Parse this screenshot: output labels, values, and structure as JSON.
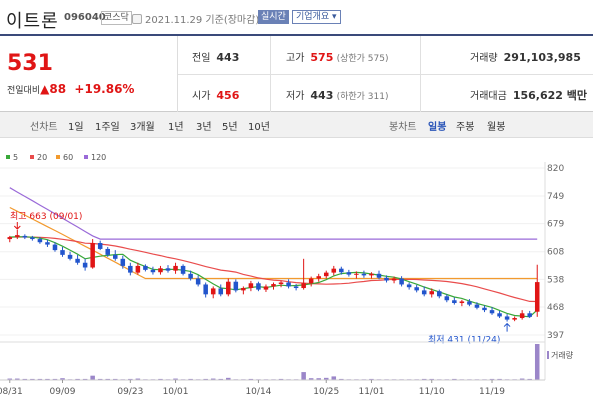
{
  "header": {
    "stock_name": "이트론",
    "stock_code": "096040",
    "market": "코스닥",
    "date": "2021.11.29 기준(장마감)",
    "realtime_label": "실시간",
    "company_label": "기업개요 ▾"
  },
  "price": {
    "current": "531",
    "change_label": "전일대비",
    "change_value": "▲88",
    "change_pct": "+19.86%"
  },
  "stats": {
    "prev_close_label": "전일",
    "prev_close": "443",
    "high_label": "고가",
    "high": "575",
    "high_sub": "(상한가 575)",
    "volume_label": "거래량",
    "volume": "291,103,985",
    "open_label": "시가",
    "open": "456",
    "low_label": "저가",
    "low": "443",
    "low_sub": "(하한가 311)",
    "amount_label": "거래대금",
    "amount": "156,622 백만"
  },
  "periods": {
    "line_chart_label": "선차트",
    "line_options": [
      "1일",
      "1주일",
      "3개월",
      "1년",
      "3년",
      "5년",
      "10년"
    ],
    "candle_chart_label": "봉차트",
    "candle_options": [
      "일봉",
      "주봉",
      "월봉"
    ],
    "active_candle": "일봉"
  },
  "colors": {
    "up": "#e01515",
    "down": "#2255cc",
    "ma5": "#39a839",
    "ma20": "#e94c4c",
    "ma60": "#f29a2e",
    "ma120": "#9a6ad8",
    "volume": "#9b86c9"
  },
  "chart_data": {
    "type": "candlestick",
    "legend": [
      {
        "name": "5",
        "color": "#39a839"
      },
      {
        "name": "20",
        "color": "#e94c4c"
      },
      {
        "name": "60",
        "color": "#f29a2e"
      },
      {
        "name": "120",
        "color": "#9a6ad8"
      }
    ],
    "y_ticks": [
      820,
      749,
      679,
      608,
      538,
      468,
      397
    ],
    "ylim": [
      397,
      820
    ],
    "x_ticks": [
      "08/31",
      "09/09",
      "09/23",
      "10/01",
      "10/14",
      "10/25",
      "11/01",
      "11/10",
      "11/19"
    ],
    "annotations": {
      "high": "최고 663 (09/01)",
      "low": "최저 431 (11/24)"
    },
    "volume_label": "거래량",
    "candles": [
      [
        640,
        648,
        632,
        645
      ],
      [
        645,
        663,
        640,
        650
      ],
      [
        648,
        652,
        640,
        644
      ],
      [
        644,
        648,
        636,
        640
      ],
      [
        640,
        645,
        628,
        632
      ],
      [
        632,
        638,
        620,
        626
      ],
      [
        626,
        632,
        608,
        612
      ],
      [
        612,
        620,
        595,
        600
      ],
      [
        600,
        608,
        586,
        590
      ],
      [
        590,
        600,
        575,
        580
      ],
      [
        580,
        590,
        560,
        568
      ],
      [
        568,
        640,
        565,
        630
      ],
      [
        630,
        636,
        612,
        615
      ],
      [
        615,
        620,
        595,
        600
      ],
      [
        600,
        612,
        585,
        590
      ],
      [
        590,
        598,
        565,
        572
      ],
      [
        572,
        580,
        548,
        555
      ],
      [
        555,
        580,
        550,
        572
      ],
      [
        572,
        576,
        558,
        562
      ],
      [
        562,
        570,
        550,
        556
      ],
      [
        556,
        572,
        550,
        566
      ],
      [
        566,
        574,
        555,
        560
      ],
      [
        560,
        580,
        552,
        572
      ],
      [
        572,
        576,
        548,
        552
      ],
      [
        552,
        560,
        535,
        540
      ],
      [
        540,
        548,
        520,
        525
      ],
      [
        525,
        530,
        492,
        500
      ],
      [
        500,
        520,
        490,
        515
      ],
      [
        515,
        525,
        495,
        500
      ],
      [
        500,
        540,
        495,
        532
      ],
      [
        532,
        538,
        505,
        510
      ],
      [
        510,
        520,
        500,
        516
      ],
      [
        516,
        534,
        508,
        528
      ],
      [
        528,
        532,
        508,
        512
      ],
      [
        512,
        525,
        506,
        520
      ],
      [
        520,
        530,
        512,
        526
      ],
      [
        526,
        534,
        518,
        530
      ],
      [
        530,
        538,
        515,
        520
      ],
      [
        520,
        526,
        510,
        516
      ],
      [
        516,
        590,
        512,
        528
      ],
      [
        528,
        545,
        520,
        540
      ],
      [
        540,
        552,
        532,
        546
      ],
      [
        546,
        560,
        540,
        555
      ],
      [
        555,
        572,
        548,
        565
      ],
      [
        565,
        570,
        550,
        556
      ],
      [
        556,
        562,
        545,
        550
      ],
      [
        550,
        558,
        540,
        552
      ],
      [
        552,
        560,
        542,
        548
      ],
      [
        548,
        556,
        540,
        552
      ],
      [
        552,
        560,
        538,
        542
      ],
      [
        542,
        548,
        530,
        535
      ],
      [
        535,
        545,
        528,
        540
      ],
      [
        540,
        546,
        520,
        525
      ],
      [
        525,
        530,
        512,
        518
      ],
      [
        518,
        524,
        505,
        510
      ],
      [
        510,
        520,
        495,
        500
      ],
      [
        500,
        515,
        492,
        508
      ],
      [
        508,
        512,
        490,
        495
      ],
      [
        495,
        500,
        480,
        485
      ],
      [
        485,
        492,
        474,
        478
      ],
      [
        478,
        486,
        470,
        482
      ],
      [
        482,
        488,
        470,
        474
      ],
      [
        474,
        480,
        462,
        466
      ],
      [
        466,
        472,
        455,
        460
      ],
      [
        460,
        468,
        448,
        452
      ],
      [
        452,
        458,
        440,
        444
      ],
      [
        444,
        450,
        431,
        436
      ],
      [
        436,
        444,
        432,
        440
      ],
      [
        440,
        460,
        436,
        452
      ],
      [
        452,
        458,
        440,
        443
      ],
      [
        456,
        575,
        443,
        531
      ]
    ],
    "volumes": [
      4,
      4,
      3,
      3,
      3,
      3,
      3,
      5,
      2,
      3,
      3,
      12,
      3,
      3,
      3,
      2,
      3,
      4,
      2,
      2,
      3,
      2,
      4,
      2,
      3,
      2,
      3,
      4,
      3,
      6,
      2,
      2,
      3,
      2,
      2,
      2,
      3,
      2,
      2,
      22,
      5,
      5,
      6,
      10,
      3,
      2,
      2,
      2,
      3,
      2,
      2,
      2,
      2,
      2,
      2,
      3,
      3,
      2,
      2,
      3,
      2,
      2,
      2,
      2,
      3,
      3,
      2,
      2,
      4,
      3,
      100
    ]
  }
}
